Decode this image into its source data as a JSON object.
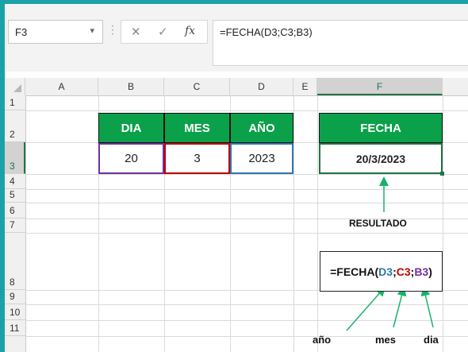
{
  "formula_bar": {
    "name_box": "F3",
    "cancel_icon": "✕",
    "enter_icon": "✓",
    "fx_label": "fx",
    "formula": "=FECHA(D3;C3;B3)"
  },
  "columns": [
    "A",
    "B",
    "C",
    "D",
    "E",
    "F"
  ],
  "rows": [
    "1",
    "2",
    "3",
    "4",
    "5",
    "6",
    "7",
    "8",
    "9",
    "10",
    "11"
  ],
  "table": {
    "headers": {
      "dia": "DIA",
      "mes": "MES",
      "anio": "AÑO",
      "fecha": "FECHA"
    },
    "values": {
      "dia": "20",
      "mes": "3",
      "anio": "2023",
      "fecha": "20/3/2023"
    }
  },
  "annotation": {
    "resultado": "RESULTADO",
    "formula_parts": {
      "prefix": "=FECHA(",
      "d3": "D3",
      "sep1": ";",
      "c3": "C3",
      "sep2": ";",
      "b3": "B3",
      "suffix": ")"
    },
    "anio_label": "año",
    "mes_label": "mes",
    "dia_label": "dia"
  },
  "colors": {
    "header_green": "#0aa14a",
    "dia_border": "#7030a0",
    "mes_border": "#c00000",
    "anio_border": "#2e75b6",
    "fecha_border": "#217346",
    "arrow": "#17b26a"
  }
}
